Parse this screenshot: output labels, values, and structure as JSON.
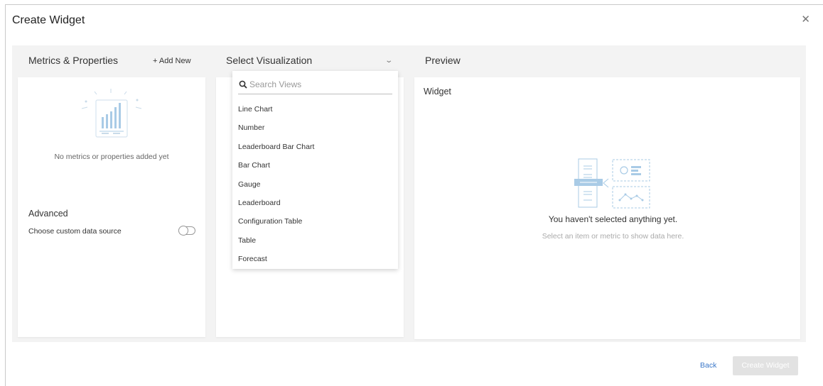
{
  "dialog": {
    "title": "Create Widget",
    "close_icon": "close-icon"
  },
  "metrics": {
    "heading": "Metrics & Properties",
    "add_new": "+ Add New",
    "empty_text": "No metrics or properties added yet",
    "advanced_heading": "Advanced",
    "custom_source_label": "Choose custom data source",
    "custom_source_enabled": false
  },
  "visualization": {
    "select_label": "Select Visualization",
    "search_placeholder": "Search Views",
    "search_value": "",
    "options": [
      "Line Chart",
      "Number",
      "Leaderboard Bar Chart",
      "Bar Chart",
      "Gauge",
      "Leaderboard",
      "Configuration Table",
      "Table",
      "Forecast"
    ]
  },
  "preview": {
    "heading": "Preview",
    "widget_label": "Widget",
    "empty_title": "You haven't selected anything yet.",
    "empty_subtitle": "Select an item or metric to show data here."
  },
  "footer": {
    "back_label": "Back",
    "create_label": "Create Widget"
  },
  "colors": {
    "workspace_bg": "#f3f3f3",
    "link_blue": "#3a77c8",
    "illustration_blue": "#a9cbe6",
    "disabled_button": "#e2e2e2"
  }
}
